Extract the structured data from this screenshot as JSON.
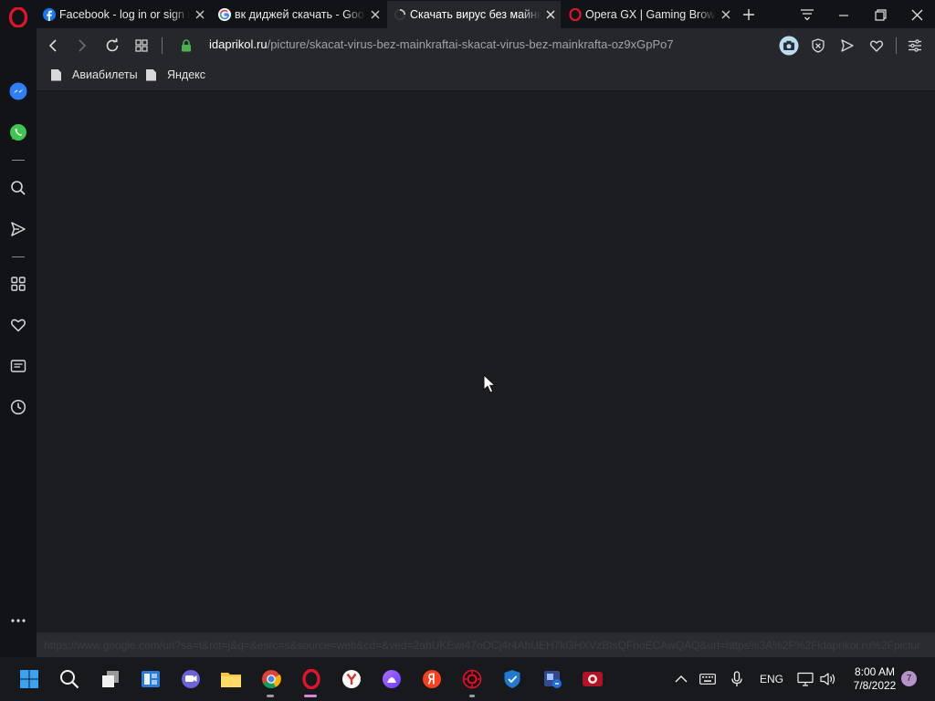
{
  "browser": {
    "tabs": [
      {
        "title": "Facebook - log in or sign up",
        "favicon": "facebook-icon",
        "active": false
      },
      {
        "title": "вк диджей скачать - Google Search",
        "favicon": "google-icon",
        "active": false
      },
      {
        "title": "Скачать вирус без майнкрафта",
        "favicon": "loading-spinner-icon",
        "active": true
      },
      {
        "title": "Opera GX | Gaming Browser",
        "favicon": "opera-icon",
        "active": false
      }
    ],
    "address": {
      "host": "idaprikol.ru",
      "path": "/picture/skacat-virus-bez-mainkraftai-skacat-virus-bez-mainkrafta-oz9xGpPo7"
    },
    "bookmarks": [
      {
        "label": "Авиабилеты"
      },
      {
        "label": "Яндекс"
      }
    ],
    "status_url": "https://www.google.com/url?sa=t&rct=j&q=&esrc=s&source=web&cd=&ved=2ahUKEwi47oOCj4r4AhUEH7kGHXVzBtsQFnoECAwQAQ&url=https%3A%2F%2Fidaprikol.ru%2Fpicture"
  },
  "sidebar": {
    "items": [
      "opera-logo-icon",
      "messenger-icon",
      "whatsapp-icon",
      "search-icon",
      "send-icon",
      "workspaces-icon",
      "heart-icon",
      "news-icon",
      "history-icon",
      "more-icon"
    ]
  },
  "taskbar": {
    "language": "ENG",
    "time": "8:00 AM",
    "date": "7/8/2022",
    "notification_count": "7"
  },
  "colors": {
    "background": "#1c1d20",
    "toolbar": "#25272b",
    "sidebar": "#121316",
    "opera_red": "#e0142b",
    "secure_green": "#4caf50"
  }
}
